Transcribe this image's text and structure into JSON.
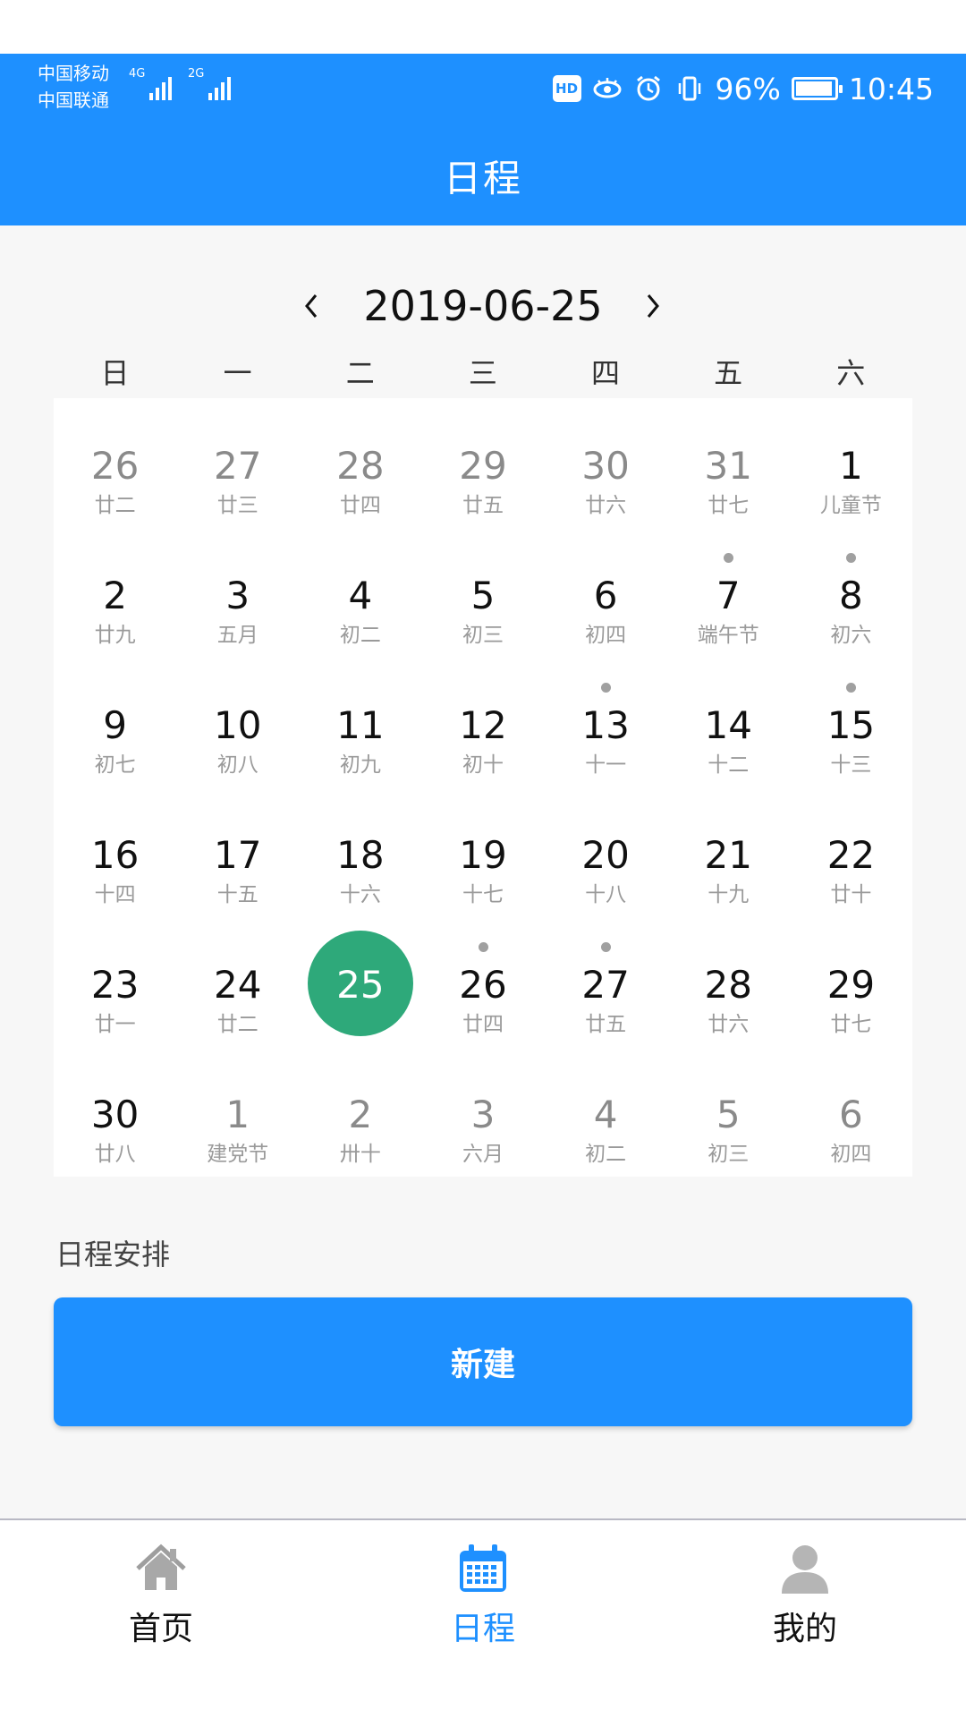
{
  "status_bar": {
    "carrier_1": "中国移动",
    "carrier_2": "中国联通",
    "network_1": "4G",
    "network_2": "2G",
    "battery_percent": "96%",
    "battery_level": 0.96,
    "time": "10:45",
    "icons": [
      "hd-icon",
      "eye-icon",
      "alarm-icon",
      "vibrate-icon",
      "battery-icon"
    ]
  },
  "header": {
    "title": "日程"
  },
  "calendar": {
    "current_date": "2019-06-25",
    "prev_symbol": "‹",
    "next_symbol": "›",
    "weekdays": [
      "日",
      "一",
      "二",
      "三",
      "四",
      "五",
      "六"
    ],
    "weeks": [
      [
        {
          "day": "26",
          "lunar": "廿二",
          "other": true
        },
        {
          "day": "27",
          "lunar": "廿三",
          "other": true
        },
        {
          "day": "28",
          "lunar": "廿四",
          "other": true
        },
        {
          "day": "29",
          "lunar": "廿五",
          "other": true
        },
        {
          "day": "30",
          "lunar": "廿六",
          "other": true
        },
        {
          "day": "31",
          "lunar": "廿七",
          "other": true
        },
        {
          "day": "1",
          "lunar": "儿童节"
        }
      ],
      [
        {
          "day": "2",
          "lunar": "廿九"
        },
        {
          "day": "3",
          "lunar": "五月"
        },
        {
          "day": "4",
          "lunar": "初二"
        },
        {
          "day": "5",
          "lunar": "初三"
        },
        {
          "day": "6",
          "lunar": "初四"
        },
        {
          "day": "7",
          "lunar": "端午节",
          "event": true
        },
        {
          "day": "8",
          "lunar": "初六",
          "event": true
        }
      ],
      [
        {
          "day": "9",
          "lunar": "初七"
        },
        {
          "day": "10",
          "lunar": "初八"
        },
        {
          "day": "11",
          "lunar": "初九"
        },
        {
          "day": "12",
          "lunar": "初十"
        },
        {
          "day": "13",
          "lunar": "十一",
          "event": true
        },
        {
          "day": "14",
          "lunar": "十二"
        },
        {
          "day": "15",
          "lunar": "十三",
          "event": true
        }
      ],
      [
        {
          "day": "16",
          "lunar": "十四"
        },
        {
          "day": "17",
          "lunar": "十五"
        },
        {
          "day": "18",
          "lunar": "十六"
        },
        {
          "day": "19",
          "lunar": "十七"
        },
        {
          "day": "20",
          "lunar": "十八"
        },
        {
          "day": "21",
          "lunar": "十九"
        },
        {
          "day": "22",
          "lunar": "廿十"
        }
      ],
      [
        {
          "day": "23",
          "lunar": "廿一"
        },
        {
          "day": "24",
          "lunar": "廿二"
        },
        {
          "day": "25",
          "lunar": "",
          "selected": true
        },
        {
          "day": "26",
          "lunar": "廿四",
          "event": true
        },
        {
          "day": "27",
          "lunar": "廿五",
          "event": true
        },
        {
          "day": "28",
          "lunar": "廿六"
        },
        {
          "day": "29",
          "lunar": "廿七"
        }
      ],
      [
        {
          "day": "30",
          "lunar": "廿八"
        },
        {
          "day": "1",
          "lunar": "建党节",
          "other": true
        },
        {
          "day": "2",
          "lunar": "卅十",
          "other": true
        },
        {
          "day": "3",
          "lunar": "六月",
          "other": true
        },
        {
          "day": "4",
          "lunar": "初二",
          "other": true
        },
        {
          "day": "5",
          "lunar": "初三",
          "other": true
        },
        {
          "day": "6",
          "lunar": "初四",
          "other": true
        }
      ]
    ]
  },
  "schedule": {
    "title": "日程安排",
    "new_button_label": "新建"
  },
  "tab_bar": {
    "tabs": [
      {
        "label": "首页",
        "icon": "home-icon",
        "active": false
      },
      {
        "label": "日程",
        "icon": "calendar-icon",
        "active": true
      },
      {
        "label": "我的",
        "icon": "user-icon",
        "active": false
      }
    ]
  },
  "colors": {
    "primary": "#1e90ff",
    "selected_day": "#2ea97a",
    "event_dot": "#a0a0a0",
    "muted_text": "#8a8a8a"
  }
}
